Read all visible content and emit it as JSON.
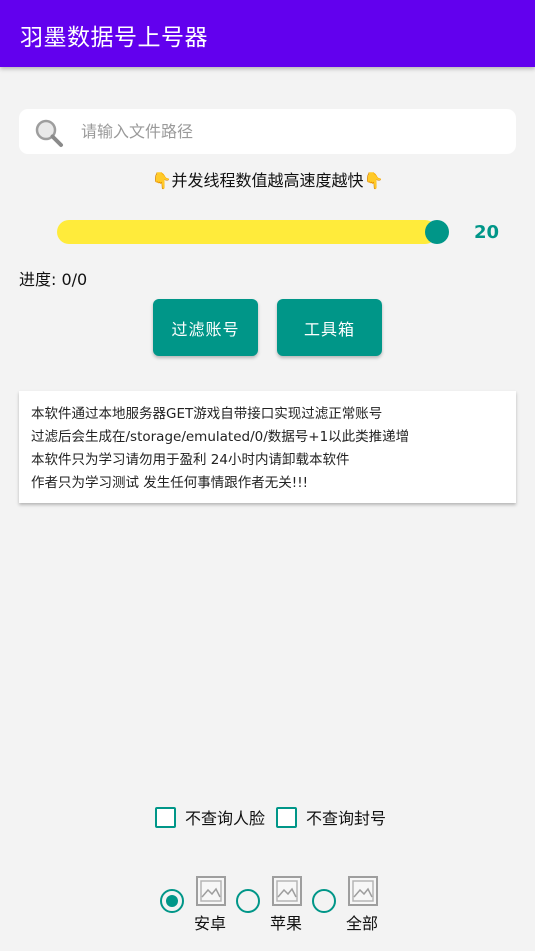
{
  "app": {
    "title": "羽墨数据号上号器"
  },
  "search": {
    "placeholder": "请输入文件路径",
    "value": ""
  },
  "hint": {
    "text": "并发线程数值越高速度越快",
    "hand_left": "👇",
    "hand_right": "👇"
  },
  "slider": {
    "value": "20",
    "fraction": 0.95
  },
  "progress": {
    "text": "进度: 0/0"
  },
  "buttons": {
    "filter": "过滤账号",
    "tools": "工具箱"
  },
  "notice": {
    "lines": [
      "本软件通过本地服务器GET游戏自带接口实现过滤正常账号",
      "过滤后会生成在/storage/emulated/0/数据号+1以此类推递增",
      "本软件只为学习请勿用于盈利 24小时内请卸载本软件",
      "作者只为学习测试 发生任何事情跟作者无关!!!"
    ]
  },
  "checkboxes": {
    "no_face": "不查询人脸",
    "no_ban": "不查询封号"
  },
  "platforms": {
    "android": "安卓",
    "ios": "苹果",
    "all": "全部",
    "selected": "android"
  },
  "colors": {
    "primary": "#6200ee",
    "accent": "#009688",
    "slider_track": "#ffeb3b"
  },
  "icons": {
    "search": "search-icon",
    "platform": "image-placeholder-icon"
  }
}
